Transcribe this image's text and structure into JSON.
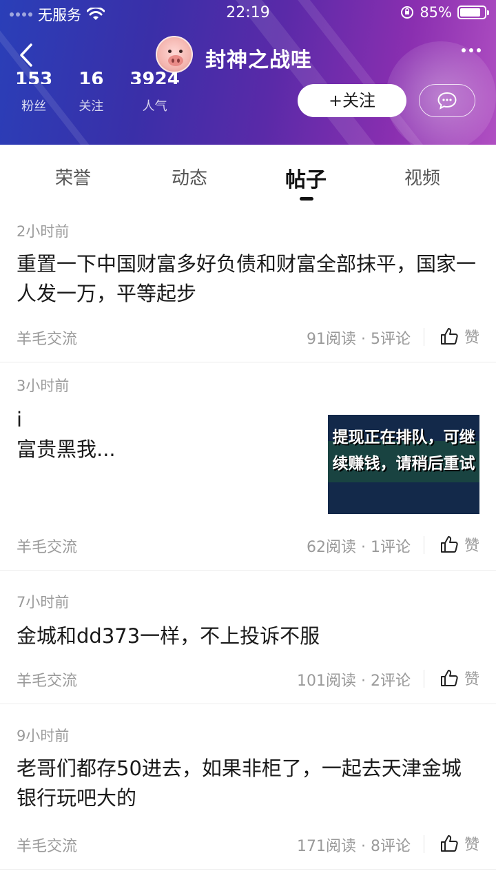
{
  "status_bar": {
    "carrier": "无服务",
    "time": "22:19",
    "battery": "85%",
    "battery_level": 0.85
  },
  "profile": {
    "nickname": "封神之战哇",
    "stats": [
      {
        "value": "153",
        "label": "粉丝"
      },
      {
        "value": "16",
        "label": "关注"
      },
      {
        "value": "3924",
        "label": "人气"
      }
    ],
    "follow_label": "+关注"
  },
  "tabs": [
    {
      "label": "荣誉",
      "active": false
    },
    {
      "label": "动态",
      "active": false
    },
    {
      "label": "帖子",
      "active": true
    },
    {
      "label": "视频",
      "active": false
    }
  ],
  "posts": [
    {
      "time": "2小时前",
      "content": "重置一下中国财富多好负债和财富全部抹平，国家一人发一万，平等起步",
      "forum": "羊毛交流",
      "counts": "91阅读 · 5评论",
      "like_label": "赞"
    },
    {
      "time": "3小时前",
      "content_line1": "i",
      "content_line2": "富贵黑我...",
      "thumb_text": "提现正在排队，可继续赚钱，请稍后重试",
      "forum": "羊毛交流",
      "counts": "62阅读 · 1评论",
      "like_label": "赞"
    },
    {
      "time": "7小时前",
      "content": "金城和dd373一样，不上投诉不服",
      "forum": "羊毛交流",
      "counts": "101阅读 · 2评论",
      "like_label": "赞"
    },
    {
      "time": "9小时前",
      "content": "老哥们都存50进去，如果非柜了，一起去天津金城银行玩吧大的",
      "forum": "羊毛交流",
      "counts": "171阅读 · 8评论",
      "like_label": "赞"
    }
  ]
}
